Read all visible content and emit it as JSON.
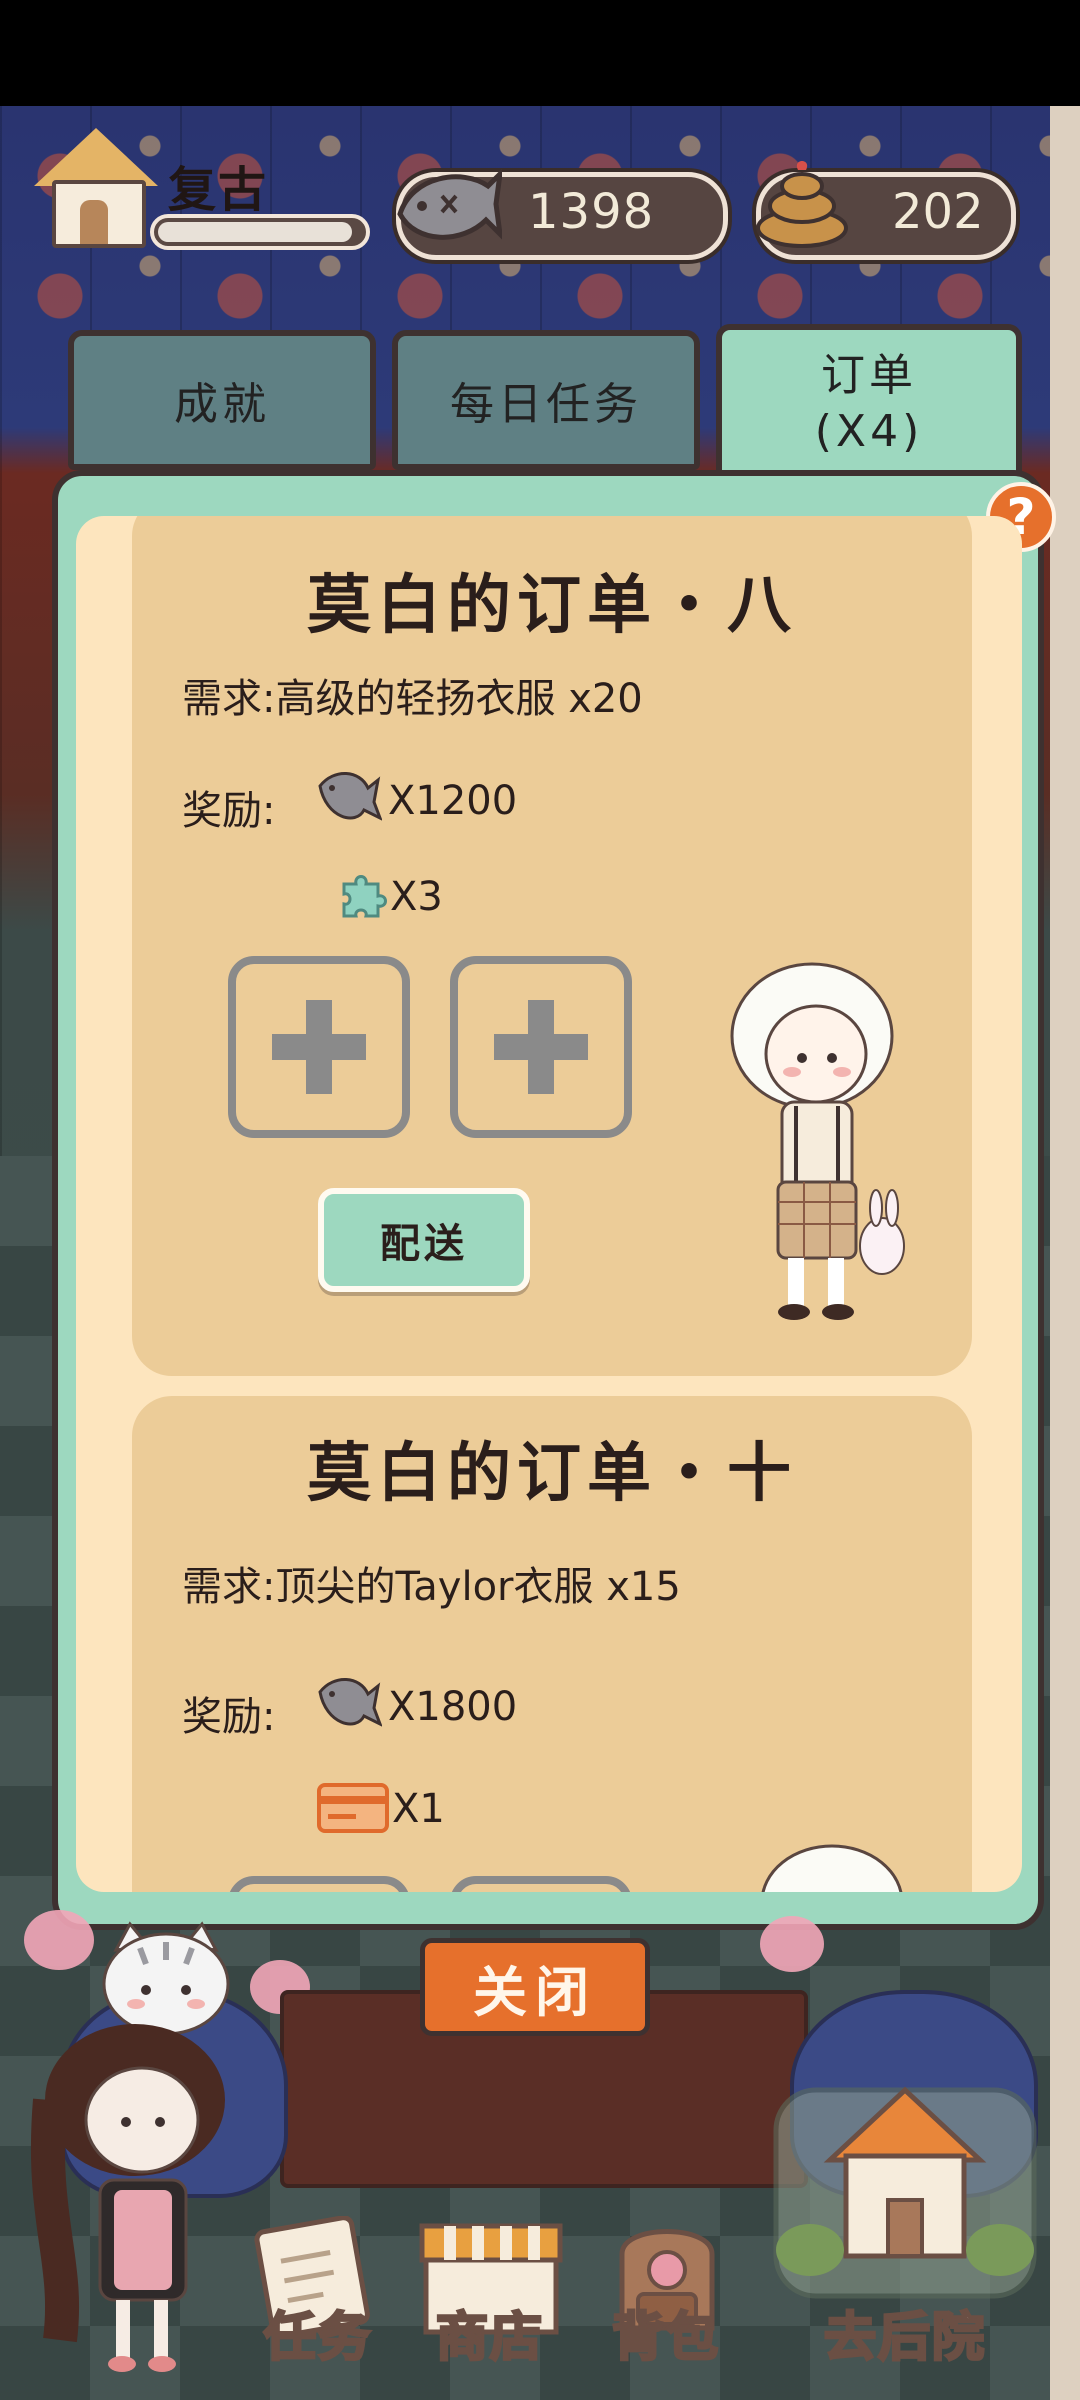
{
  "player": {
    "name": "复古",
    "progress": 0.95
  },
  "currency": {
    "fish": "1398",
    "poop": "202"
  },
  "tabs": {
    "achievement": "成就",
    "daily": "每日任务",
    "orders_line1": "订单",
    "orders_line2": "(X4)"
  },
  "help_label": "?",
  "orders": [
    {
      "title": "莫白的订单・八",
      "requirement": "需求:高级的轻扬衣服  x20",
      "reward_label": "奖励:",
      "reward_fish": "X1200",
      "reward_item": "X3",
      "reward_item_icon": "puzzle-piece-icon",
      "deliver_label": "配送"
    },
    {
      "title": "莫白的订单・十",
      "requirement": "需求:顶尖的Taylor衣服  x15",
      "reward_label": "奖励:",
      "reward_fish": "X1800",
      "reward_item": "X1",
      "reward_item_icon": "card-icon"
    }
  ],
  "close_label": "关闭",
  "nav": {
    "tasks": "任务",
    "shop": "商店",
    "bag": "背包",
    "backyard": "去后院"
  },
  "colors": {
    "accent_orange": "#e6702c",
    "panel_green": "#9dd8bf",
    "card_tan": "#eccc98",
    "inner_cream": "#fde5be"
  }
}
